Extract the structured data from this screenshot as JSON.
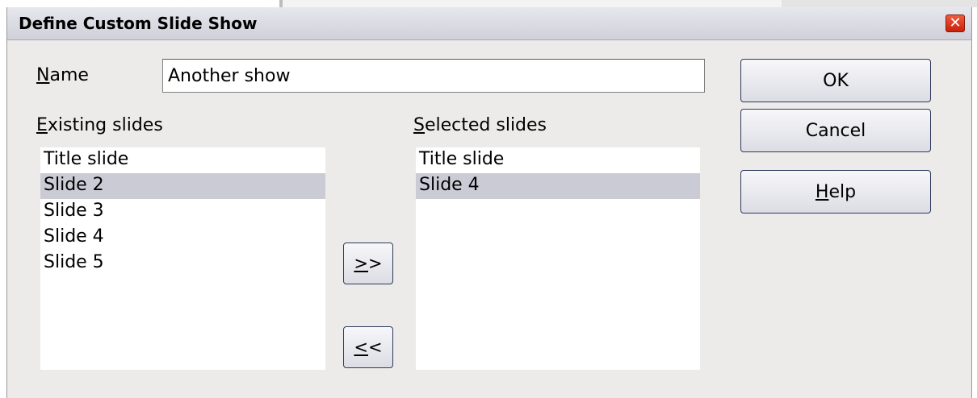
{
  "window": {
    "title": "Define Custom Slide Show"
  },
  "name_field": {
    "label_mnemonic": "N",
    "label_rest": "ame",
    "value": "Another show"
  },
  "existing": {
    "label_mnemonic": "E",
    "label_rest": "xisting slides",
    "items": [
      "Title slide",
      "Slide 2",
      "Slide 3",
      "Slide 4",
      "Slide 5"
    ],
    "selected_index": 1
  },
  "selected": {
    "label_mnemonic": "S",
    "label_rest": "elected slides",
    "items": [
      "Title slide",
      "Slide 4"
    ],
    "selected_index": 1
  },
  "buttons": {
    "add_mnemonic": ">",
    "add_rest": ">",
    "remove_mnemonic": "<",
    "remove_rest": "<",
    "ok": "OK",
    "cancel": "Cancel",
    "help_mnemonic": "H",
    "help_rest": "elp"
  },
  "colors": {
    "selection": "#cbcbd6",
    "close_button": "#d8301a",
    "dialog_bg": "#ecebe9"
  }
}
